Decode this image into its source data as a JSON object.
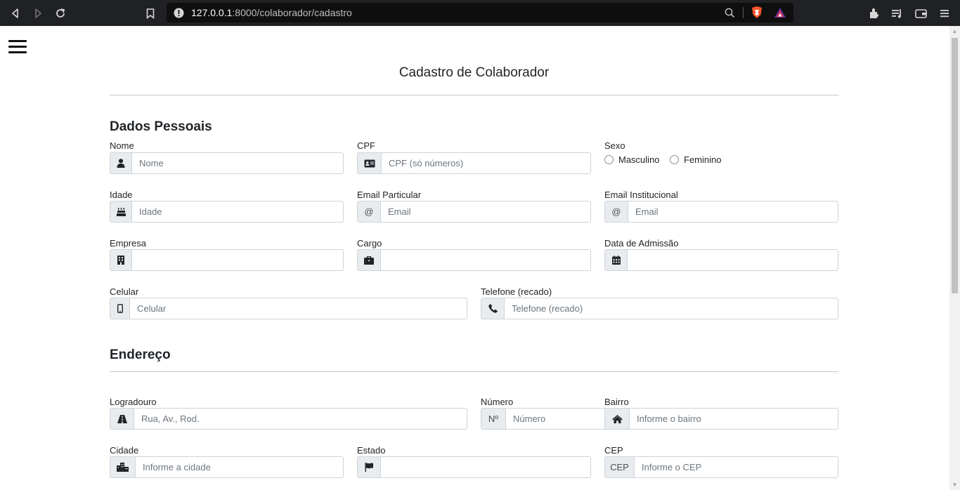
{
  "browser": {
    "url_host": "127.0.0.1",
    "url_rest": ":8000/colaborador/cadastro"
  },
  "page": {
    "title": "Cadastro de Colaborador",
    "personal_section": "Dados Pessoais",
    "address_section": "Endereço"
  },
  "fields": {
    "nome": {
      "label": "Nome",
      "placeholder": "Nome"
    },
    "cpf": {
      "label": "CPF",
      "placeholder": "CPF (só números)"
    },
    "sexo": {
      "label": "Sexo",
      "option1": "Masculino",
      "option2": "Feminino"
    },
    "idade": {
      "label": "Idade",
      "placeholder": "Idade"
    },
    "email_particular": {
      "label": "Email Particular",
      "addon": "@",
      "placeholder": "Email"
    },
    "email_institucional": {
      "label": "Email Institucional",
      "addon": "@",
      "placeholder": "Email"
    },
    "empresa": {
      "label": "Empresa",
      "placeholder": ""
    },
    "cargo": {
      "label": "Cargo",
      "placeholder": ""
    },
    "data_admissao": {
      "label": "Data de Admissão",
      "placeholder": ""
    },
    "celular": {
      "label": "Celular",
      "placeholder": "Celular"
    },
    "telefone": {
      "label": "Telefone (recado)",
      "placeholder": "Telefone (recado)"
    },
    "logradouro": {
      "label": "Logradouro",
      "placeholder": "Rua, Av., Rod."
    },
    "numero": {
      "label": "Número",
      "addon": "Nº",
      "placeholder": "Número"
    },
    "bairro": {
      "label": "Bairro",
      "placeholder": "Informe o bairro"
    },
    "cidade": {
      "label": "Cidade",
      "placeholder": "Informe a cidade"
    },
    "estado": {
      "label": "Estado",
      "placeholder": ""
    },
    "cep": {
      "label": "CEP",
      "addon": "CEP",
      "placeholder": "Informe o CEP"
    }
  },
  "icons": {
    "nome": "user-icon",
    "cpf": "id-card-icon",
    "idade": "birthday-cake-icon",
    "empresa": "building-icon",
    "cargo": "briefcase-icon",
    "data_admissao": "calendar-icon",
    "celular": "mobile-phone-icon",
    "telefone": "phone-icon",
    "logradouro": "road-icon",
    "bairro": "home-icon",
    "cidade": "city-icon",
    "estado": "flag-icon"
  },
  "colors": {
    "addon_bg": "#e9ecef",
    "border": "#ced4da",
    "browser_bar": "#202124"
  }
}
